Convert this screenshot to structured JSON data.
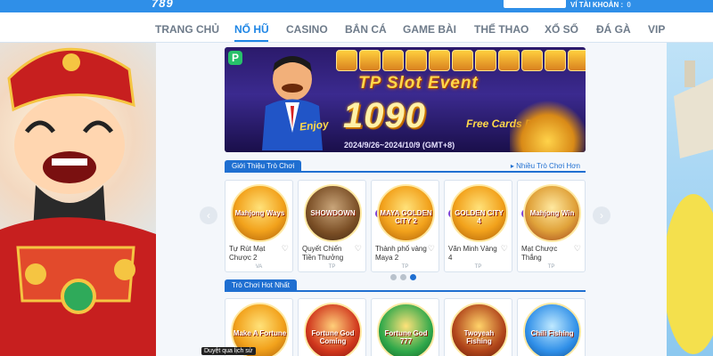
{
  "header": {
    "logo": "789",
    "wallet_label": "VÍ TÀI KHOẢN :",
    "wallet_amount": "0"
  },
  "nav": {
    "items": [
      {
        "label": "TRANG CHỦ"
      },
      {
        "label": "NỔ HŨ"
      },
      {
        "label": "CASINO"
      },
      {
        "label": "BẮN CÁ"
      },
      {
        "label": "GAME BÀI"
      },
      {
        "label": "THỂ THAO"
      },
      {
        "label": "XỔ SỐ"
      },
      {
        "label": "ĐÁ GÀ"
      },
      {
        "label": "VIP"
      }
    ],
    "active_index": 1
  },
  "banner": {
    "badge": "P",
    "title": "TP Slot Event",
    "enjoy": "Enjoy",
    "amount": "1090",
    "subtitle": "Free Cards Daily",
    "dates": "2024/9/26~2024/10/9 (GMT+8)"
  },
  "section_intro": {
    "title": "Giới Thiệu Trò Chơi",
    "more": "▸ Nhiều Trò Chơi Hơn"
  },
  "intro_games": [
    {
      "name": "Tự Rút Mạt Chược 2",
      "thumb": "Mahjong Ways",
      "provider": "VA"
    },
    {
      "name": "Quyết Chiến Tiền Thưởng",
      "thumb": "SHOWDOWN",
      "provider": "TP"
    },
    {
      "name": "Thành phố vàng Maya 2",
      "thumb": "MAYA GOLDEN CITY 2",
      "provider": "TP"
    },
    {
      "name": "Văn Minh Vàng 4",
      "thumb": "GOLDEN CITY 4",
      "provider": "TP"
    },
    {
      "name": "Mạt Chược Thắng",
      "thumb": "Mahjong Win",
      "provider": "TP"
    }
  ],
  "section_hot": {
    "title": "Trò Chơi Hot Nhất"
  },
  "hot_games": [
    {
      "thumb": "Make A Fortune"
    },
    {
      "thumb": "Fortune God Coming"
    },
    {
      "thumb": "Fortune God 777"
    },
    {
      "thumb": "Twoyeah Fishing"
    },
    {
      "thumb": "Chili Fishing"
    }
  ],
  "tooltip": "Duyệt qua lịch sử",
  "colors": {
    "accent": "#1f86e5",
    "section_blue": "#1f6fd1",
    "topbar": "#2f8fe8"
  }
}
